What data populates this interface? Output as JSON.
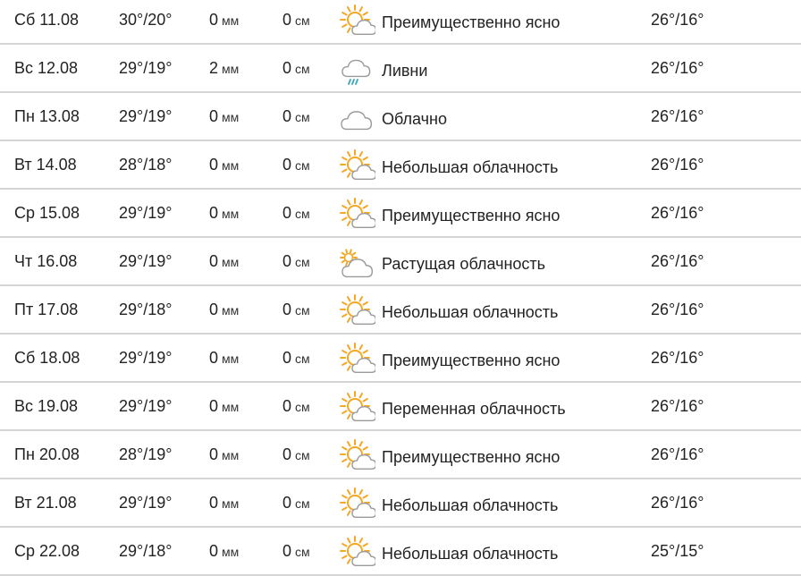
{
  "rows": [
    {
      "date": "Сб 11.08",
      "temp": "30°/20°",
      "rain": "0",
      "rain_unit": "мм",
      "snow": "0",
      "snow_unit": "см",
      "icon": "sun-cloud-icon",
      "desc": "Преимущественно ясно",
      "norm": "26°/16°"
    },
    {
      "date": "Вс 12.08",
      "temp": "29°/19°",
      "rain": "2",
      "rain_unit": "мм",
      "snow": "0",
      "snow_unit": "см",
      "icon": "rain-cloud-icon",
      "desc": "Ливни",
      "norm": "26°/16°"
    },
    {
      "date": "Пн 13.08",
      "temp": "29°/19°",
      "rain": "0",
      "rain_unit": "мм",
      "snow": "0",
      "snow_unit": "см",
      "icon": "cloud-icon",
      "desc": "Облачно",
      "norm": "26°/16°"
    },
    {
      "date": "Вт 14.08",
      "temp": "28°/18°",
      "rain": "0",
      "rain_unit": "мм",
      "snow": "0",
      "snow_unit": "см",
      "icon": "sun-cloud-icon",
      "desc": "Небольшая облачность",
      "norm": "26°/16°"
    },
    {
      "date": "Ср 15.08",
      "temp": "29°/19°",
      "rain": "0",
      "rain_unit": "мм",
      "snow": "0",
      "snow_unit": "см",
      "icon": "sun-cloud-icon",
      "desc": "Преимущественно ясно",
      "norm": "26°/16°"
    },
    {
      "date": "Чт 16.08",
      "temp": "29°/19°",
      "rain": "0",
      "rain_unit": "мм",
      "snow": "0",
      "snow_unit": "см",
      "icon": "small-sun-cloud-icon",
      "desc": "Растущая облачность",
      "norm": "26°/16°"
    },
    {
      "date": "Пт 17.08",
      "temp": "29°/18°",
      "rain": "0",
      "rain_unit": "мм",
      "snow": "0",
      "snow_unit": "см",
      "icon": "sun-cloud-icon",
      "desc": "Небольшая облачность",
      "norm": "26°/16°"
    },
    {
      "date": "Сб 18.08",
      "temp": "29°/19°",
      "rain": "0",
      "rain_unit": "мм",
      "snow": "0",
      "snow_unit": "см",
      "icon": "sun-cloud-icon",
      "desc": "Преимущественно ясно",
      "norm": "26°/16°"
    },
    {
      "date": "Вс 19.08",
      "temp": "29°/19°",
      "rain": "0",
      "rain_unit": "мм",
      "snow": "0",
      "snow_unit": "см",
      "icon": "sun-cloud-icon",
      "desc": "Переменная облачность",
      "norm": "26°/16°"
    },
    {
      "date": "Пн 20.08",
      "temp": "28°/19°",
      "rain": "0",
      "rain_unit": "мм",
      "snow": "0",
      "snow_unit": "см",
      "icon": "sun-cloud-icon",
      "desc": "Преимущественно ясно",
      "norm": "26°/16°"
    },
    {
      "date": "Вт 21.08",
      "temp": "29°/19°",
      "rain": "0",
      "rain_unit": "мм",
      "snow": "0",
      "snow_unit": "см",
      "icon": "sun-cloud-icon",
      "desc": "Небольшая облачность",
      "norm": "26°/16°"
    },
    {
      "date": "Ср 22.08",
      "temp": "29°/18°",
      "rain": "0",
      "rain_unit": "мм",
      "snow": "0",
      "snow_unit": "см",
      "icon": "sun-cloud-icon",
      "desc": "Небольшая облачность",
      "norm": "25°/15°"
    }
  ],
  "colors": {
    "sun": "#f5a623",
    "cloud": "#9a9a9a",
    "rain": "#3aa6b9",
    "divider": "#d4d4d4"
  }
}
